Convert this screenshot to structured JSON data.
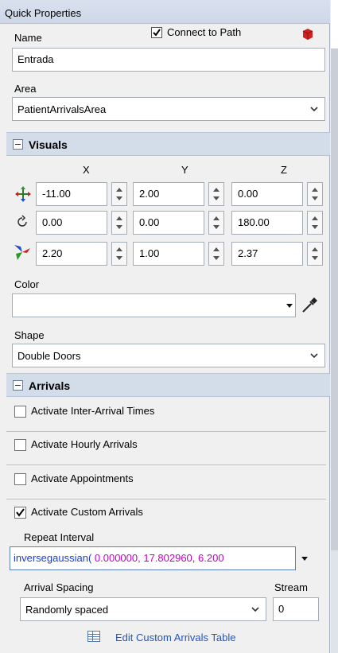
{
  "panel": {
    "title": "Quick Properties"
  },
  "general": {
    "name_label": "Name",
    "name_value": "Entrada",
    "connect_label": "Connect to Path",
    "connect_checked": true,
    "area_label": "Area",
    "area_value": "PatientArrivalsArea"
  },
  "visuals": {
    "header": "Visuals",
    "col_x": "X",
    "col_y": "Y",
    "col_z": "Z",
    "position": [
      "-11.00",
      "2.00",
      "0.00"
    ],
    "rotation": [
      "0.00",
      "0.00",
      "180.00"
    ],
    "size": [
      "2.20",
      "1.00",
      "2.37"
    ],
    "color_label": "Color",
    "color_value": "",
    "shape_label": "Shape",
    "shape_value": "Double Doors"
  },
  "arrivals": {
    "header": "Arrivals",
    "options": [
      {
        "label": "Activate Inter-Arrival Times",
        "checked": false
      },
      {
        "label": "Activate Hourly Arrivals",
        "checked": false
      },
      {
        "label": "Activate Appointments",
        "checked": false
      },
      {
        "label": "Activate Custom Arrivals",
        "checked": true
      }
    ],
    "repeat_label": "Repeat Interval",
    "repeat_fn": "inversegaussian(",
    "repeat_args": " 0.000000, 17.802960, 6.200",
    "spacing_label": "Arrival Spacing",
    "spacing_value": "Randomly spaced",
    "stream_label": "Stream",
    "stream_value": "0",
    "edit_link": "Edit Custom Arrivals Table"
  },
  "colors": {
    "header_bg": "#d3dce9",
    "link": "#2255c4",
    "function_text": "#1a3cd6",
    "argument_text": "#c000c0"
  }
}
